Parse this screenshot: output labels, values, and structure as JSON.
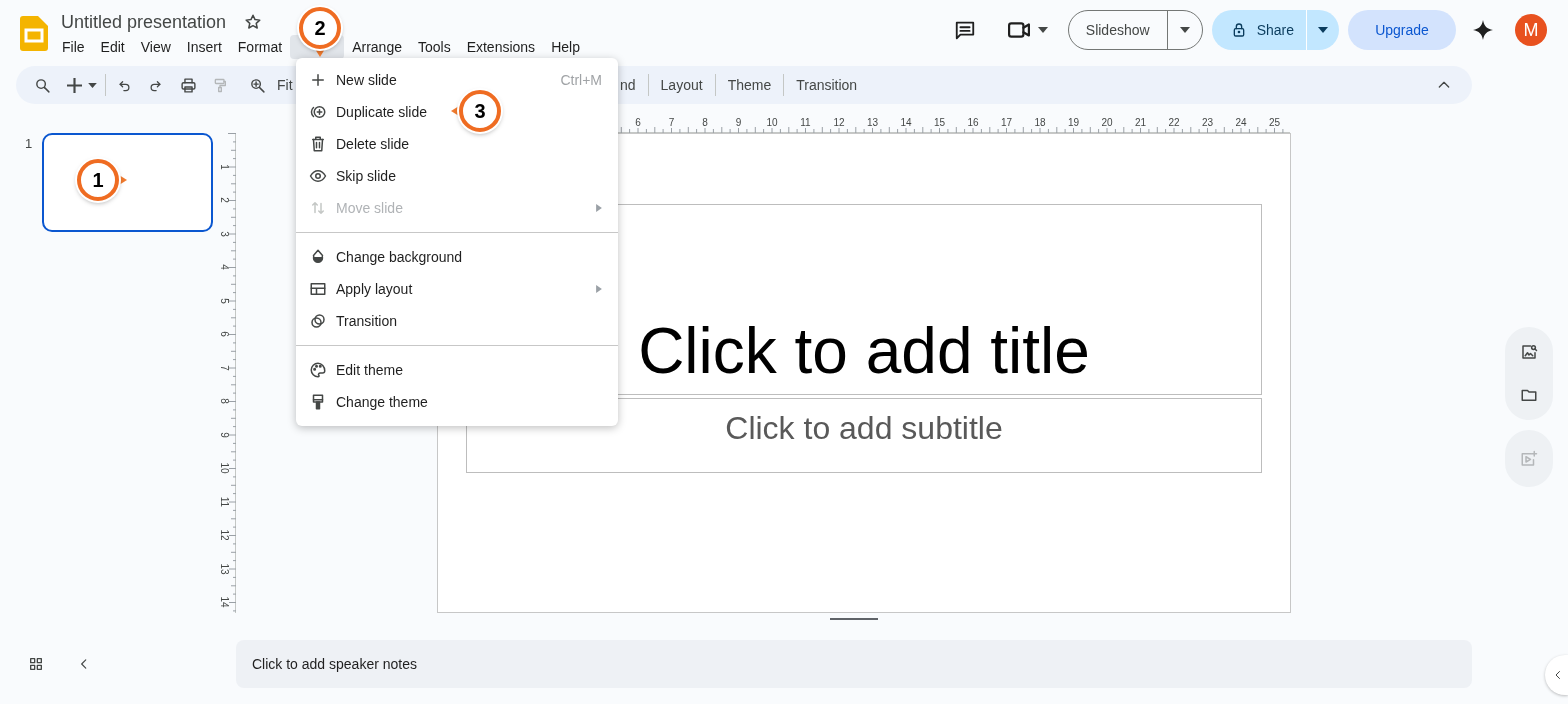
{
  "app": {
    "title": "Untitled presentation",
    "starred": false
  },
  "menu_bar": [
    {
      "label": "File",
      "open": false
    },
    {
      "label": "Edit",
      "open": false
    },
    {
      "label": "View",
      "open": false
    },
    {
      "label": "Insert",
      "open": false
    },
    {
      "label": "Format",
      "open": false
    },
    {
      "open": true
    },
    {
      "label": "Arrange",
      "open": false
    },
    {
      "label": "Tools",
      "open": false
    },
    {
      "label": "Extensions",
      "open": false
    },
    {
      "label": "Help",
      "open": false
    }
  ],
  "header_buttons": {
    "slideshow": "Slideshow",
    "share": "Share",
    "upgrade": "Upgrade",
    "avatar": "M"
  },
  "toolbar": {
    "zoom_label": "Fit",
    "partial_label": "nd",
    "buttons": [
      "Layout",
      "Theme",
      "Transition"
    ]
  },
  "filmstrip": [
    {
      "number": "1",
      "selected": true
    }
  ],
  "ruler": {
    "horizontal": [
      "6",
      "7",
      "8",
      "9",
      "10",
      "11",
      "12",
      "13",
      "14",
      "15",
      "16",
      "17",
      "18",
      "19",
      "20",
      "21",
      "22",
      "23",
      "24",
      "25"
    ],
    "vertical": [
      "1",
      "2",
      "3",
      "4",
      "5",
      "6",
      "7",
      "8",
      "9",
      "10",
      "11",
      "12",
      "13",
      "14"
    ]
  },
  "slide": {
    "title_placeholder": "Click to add title",
    "subtitle_placeholder": "Click to add subtitle"
  },
  "dropdown": {
    "groups": [
      [
        {
          "label": "New slide",
          "shortcut": "Ctrl+M",
          "disabled": false,
          "submenu": false
        },
        {
          "label": "Duplicate slide",
          "disabled": false,
          "submenu": false
        },
        {
          "label": "Delete slide",
          "disabled": false,
          "submenu": false
        },
        {
          "label": "Skip slide",
          "disabled": false,
          "submenu": false
        },
        {
          "label": "Move slide",
          "disabled": true,
          "submenu": true
        }
      ],
      [
        {
          "label": "Change background",
          "disabled": false,
          "submenu": false
        },
        {
          "label": "Apply layout",
          "disabled": false,
          "submenu": true
        },
        {
          "label": "Transition",
          "disabled": false,
          "submenu": false
        }
      ],
      [
        {
          "label": "Edit theme",
          "disabled": false,
          "submenu": false
        },
        {
          "label": "Change theme",
          "disabled": false,
          "submenu": false
        }
      ]
    ]
  },
  "speaker_notes": {
    "placeholder": "Click to add speaker notes"
  },
  "callouts": [
    {
      "label": "1"
    },
    {
      "label": "2"
    },
    {
      "label": "3"
    }
  ]
}
